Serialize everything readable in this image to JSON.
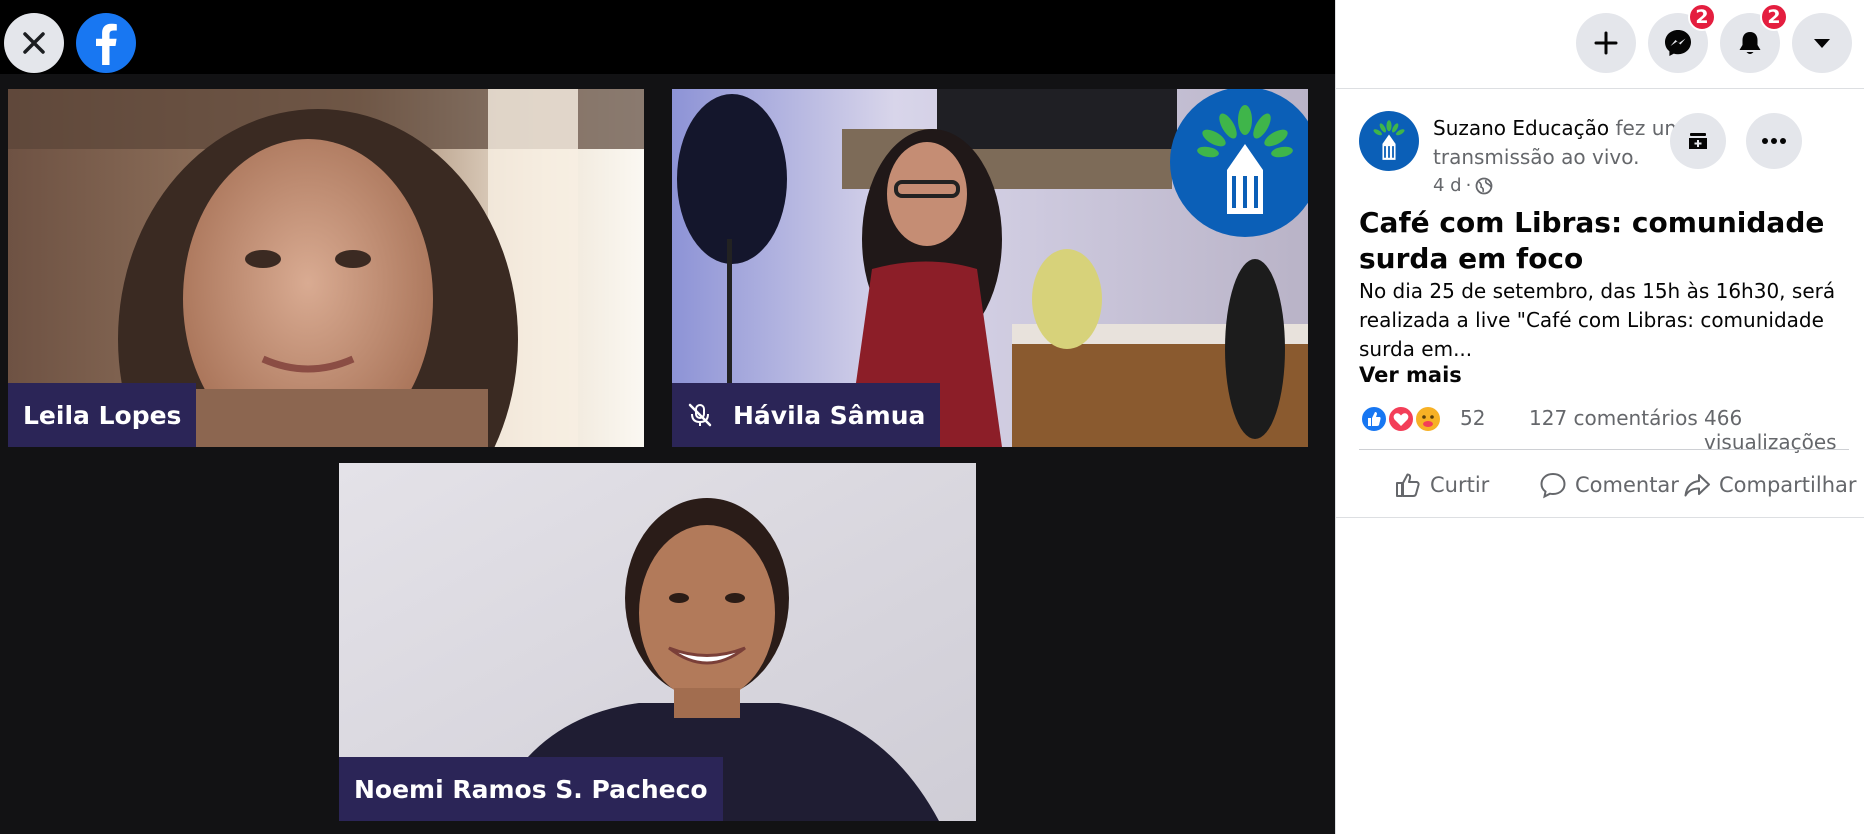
{
  "stage": {
    "close_icon": "close-icon",
    "brand_icon": "facebook-logo-icon"
  },
  "participants": [
    {
      "name": "Leila Lopes",
      "muted": false
    },
    {
      "name": "Hávila Sâmua",
      "muted": true
    },
    {
      "name": "Noemi Ramos S. Pacheco",
      "muted": false
    }
  ],
  "header": {
    "create_icon": "plus-icon",
    "messenger_icon": "messenger-icon",
    "messenger_badge": "2",
    "notifications_icon": "bell-icon",
    "notifications_badge": "2",
    "account_icon": "caret-down-icon"
  },
  "post": {
    "author": "Suzano Educação",
    "action_text": " fez uma transmissão ao vivo.",
    "time": "4 d",
    "separator": "·",
    "privacy_icon": "globe-icon",
    "title": "Café com Libras: comunidade surda em foco",
    "description": "No dia 25 de setembro, das 15h às 16h30, será realizada a live \"Café com Libras: comunidade surda em...",
    "see_more": "Ver mais",
    "reaction_count": "52",
    "comments": "127 comentários",
    "views": "466 visualizações",
    "actions": {
      "like": "Curtir",
      "comment": "Comentar",
      "share": "Compartilhar"
    }
  },
  "colors": {
    "facebook_blue": "#1877f2",
    "name_tag": "#2b2557",
    "badge_red": "#e41e3f",
    "brand_blue": "#0b5fb7",
    "brand_green": "#3fb54a"
  }
}
